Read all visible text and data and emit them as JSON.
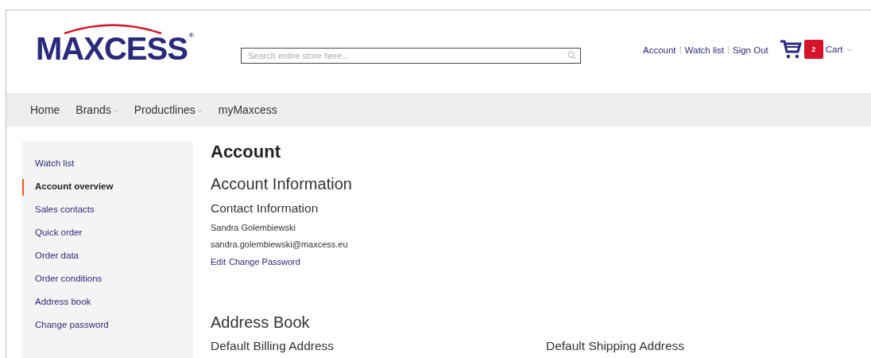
{
  "logo": {
    "text": "MAXCESS",
    "mark": "®"
  },
  "search": {
    "placeholder": "Search entire store here..."
  },
  "top_links": [
    "Account",
    "Watch list",
    "Sign Out"
  ],
  "cart": {
    "count": "2",
    "label": "Cart"
  },
  "nav": [
    {
      "label": "Home",
      "dropdown": false
    },
    {
      "label": "Brands",
      "dropdown": true
    },
    {
      "label": "Productlines",
      "dropdown": true
    },
    {
      "label": "myMaxcess",
      "dropdown": false
    }
  ],
  "sidebar": [
    {
      "label": "Watch list",
      "selected": false
    },
    {
      "label": "Account overview",
      "selected": true
    },
    {
      "label": "Sales contacts",
      "selected": false
    },
    {
      "label": "Quick order",
      "selected": false
    },
    {
      "label": "Order data",
      "selected": false
    },
    {
      "label": "Order conditions",
      "selected": false
    },
    {
      "label": "Address book",
      "selected": false
    },
    {
      "label": "Change password",
      "selected": false
    }
  ],
  "page_title": "Account",
  "account_information": {
    "title": "Account Information",
    "contact_title": "Contact Information",
    "name": "Sandra Golembiewski",
    "email": "sandra.golembiewski@maxcess.eu",
    "links": [
      "Edit",
      "Change Password"
    ]
  },
  "address_book": {
    "title": "Address Book",
    "columns": [
      "Default Billing Address",
      "Default Shipping Address"
    ]
  }
}
